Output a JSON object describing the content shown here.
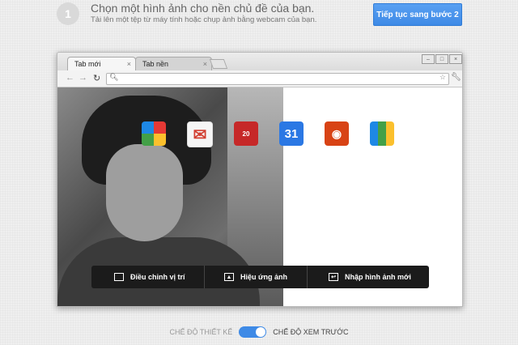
{
  "step": {
    "number": "1",
    "title": "Chọn một hình ảnh cho nền chủ đề của bạn.",
    "subtitle": "Tải lên một tệp từ máy tính hoặc chụp ảnh bằng webcam của bạn.",
    "continue_label": "Tiếp tục sang bước 2"
  },
  "browser": {
    "tabs": [
      {
        "label": "Tab mới"
      },
      {
        "label": "Tab nền"
      }
    ],
    "apps": [
      {
        "icon": "web-store-icon"
      },
      {
        "icon": "gmail-icon"
      },
      {
        "icon": "calendar-icon",
        "text": "20"
      },
      {
        "icon": "google-calendar-icon",
        "text": "31"
      },
      {
        "icon": "rss-icon"
      },
      {
        "icon": "books-icon"
      }
    ],
    "edit_actions": [
      {
        "label": "Điều chỉnh vị trí",
        "icon": "crop-icon"
      },
      {
        "label": "Hiệu ứng ảnh",
        "icon": "image-effect-icon"
      },
      {
        "label": "Nhập hình ảnh mới",
        "icon": "import-icon"
      }
    ]
  },
  "mode": {
    "design_label": "CHẾ ĐỘ THIẾT KẾ",
    "preview_label": "CHẾ ĐỘ XEM TRƯỚC",
    "preview_on": true
  },
  "colors": {
    "accent": "#3e8ae6"
  }
}
